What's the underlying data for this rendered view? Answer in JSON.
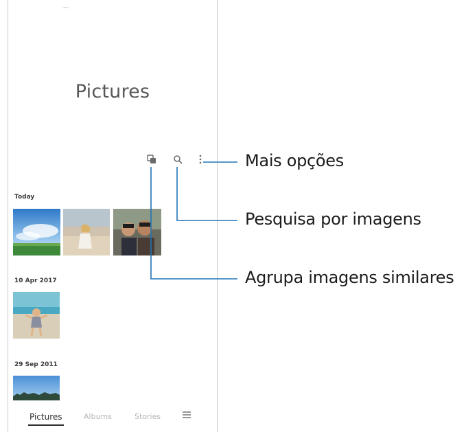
{
  "app": {
    "title": "Pictures"
  },
  "toolbar": {
    "group_icon": "group-similar-icon",
    "search_icon": "search-icon",
    "more_icon": "more-options-icon"
  },
  "sections": [
    {
      "date": "Today"
    },
    {
      "date": "10 Apr 2017"
    },
    {
      "date": "29 Sep 2011"
    }
  ],
  "bottom_nav": {
    "pictures": "Pictures",
    "albums": "Albums",
    "stories": "Stories",
    "menu_icon": "menu-icon"
  },
  "callouts": {
    "more_options": "Mais opções",
    "search_images": "Pesquisa por imagens",
    "group_similar": "Agrupa imagens similares"
  },
  "colors": {
    "callout_line": "#1e73b7"
  }
}
